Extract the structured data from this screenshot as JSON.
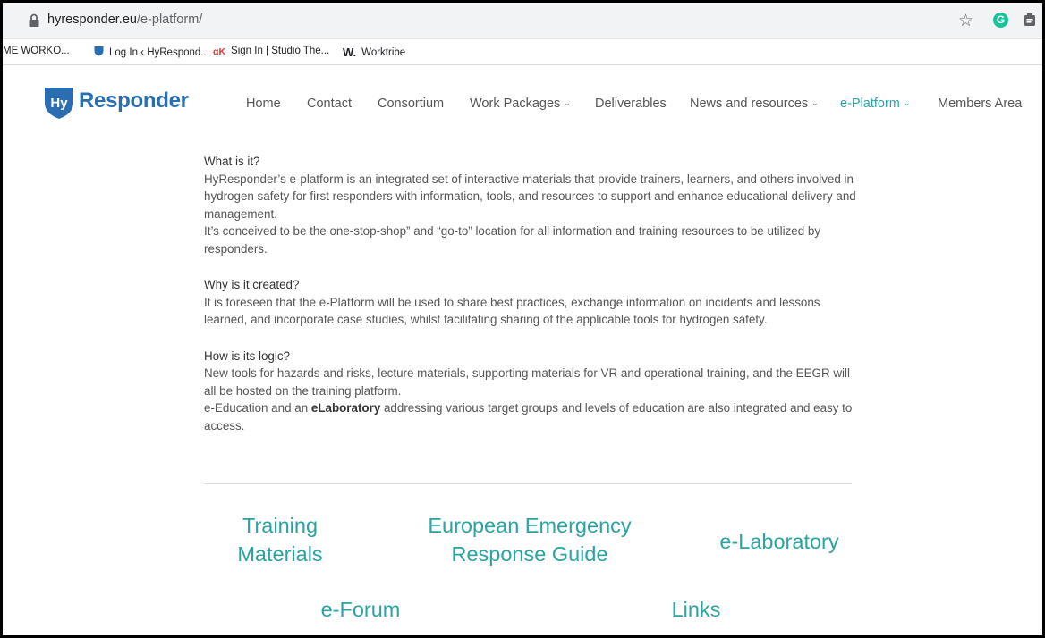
{
  "browser": {
    "url_host": "hyresponder.eu",
    "url_path": "/e-platform/",
    "bookmarks": [
      {
        "label": "ME WORKO...",
        "icon": "none"
      },
      {
        "label": "Log In ‹ HyRespond...",
        "icon": "hy-shield-icon"
      },
      {
        "label": "Sign In | Studio The...",
        "icon": "ak-icon"
      },
      {
        "label": "Worktribe",
        "icon": "w-icon",
        "prefix": "W."
      }
    ]
  },
  "site": {
    "logo_hy": "Hy",
    "logo_text": "Responder",
    "nav": [
      {
        "label": "Home",
        "dropdown": false
      },
      {
        "label": "Contact",
        "dropdown": false
      },
      {
        "label": "Consortium",
        "dropdown": false
      },
      {
        "label": "Work Packages",
        "dropdown": true
      },
      {
        "label": "Deliverables",
        "dropdown": false
      },
      {
        "label": "News and resources",
        "dropdown": true
      },
      {
        "label": "e-Platform",
        "dropdown": true,
        "active": true
      },
      {
        "label": "Members Area",
        "dropdown": false
      }
    ],
    "accent_color": "#2aa3a3",
    "logo_color": "#2b6db1"
  },
  "content": {
    "what_heading": "What is it?",
    "what_p1": "HyResponder’s e-platform is an integrated set of interactive materials that provide trainers, learners, and others involved in hydrogen safety for first responders with information, tools, and resources to support and enhance educational delivery and management.",
    "what_p2": "It’s conceived to be the one-stop-shop” and “go-to” location for all information and training resources to be utilized by responders.",
    "why_heading": "Why is it created?",
    "why_p1": "It is foreseen that the e-Platform will be used to share best practices, exchange information on incidents and lessons learned, and incorporate case studies, whilst facilitating sharing of the applicable tools for hydrogen safety.",
    "how_heading": "How is its logic?",
    "how_p1": "New tools for hazards and risks, lecture materials, supporting materials for VR and operational training, and the EEGR will all be hosted on the training platform.",
    "how_p2_pre": "e-Education and an ",
    "how_p2_bold": "eLaboratory",
    "how_p2_post": " addressing various target groups and levels of education are also integrated and easy to access."
  },
  "tiles": {
    "training_l1": "Training",
    "training_l2": "Materials",
    "eegr_l1": "European Emergency",
    "eegr_l2": "Response Guide",
    "elab": "e-Laboratory",
    "eforum": "e-Forum",
    "links": "Links"
  }
}
